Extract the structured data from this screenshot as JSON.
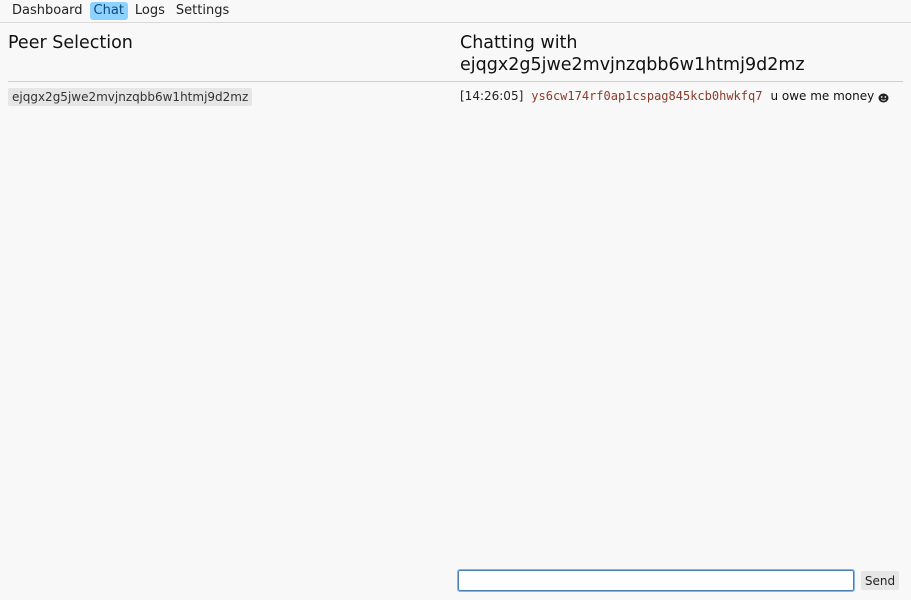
{
  "nav": {
    "tabs": [
      {
        "label": "Dashboard",
        "active": false
      },
      {
        "label": "Chat",
        "active": true
      },
      {
        "label": "Logs",
        "active": false
      },
      {
        "label": "Settings",
        "active": false
      }
    ]
  },
  "peers": {
    "title": "Peer Selection",
    "items": [
      {
        "id": "ejqgx2g5jwe2mvjnzqbb6w1htmj9d2mz"
      }
    ]
  },
  "chat": {
    "title_prefix": "Chatting with",
    "peer_id": "ejqgx2g5jwe2mvjnzqbb6w1htmj9d2mz",
    "messages": [
      {
        "time": "[14:26:05]",
        "sender": "ys6cw174rf0ap1cspag845kcb0hwkfq7",
        "text": "u owe me money",
        "icon": "emoji-icon"
      }
    ],
    "input": {
      "value": "",
      "placeholder": ""
    },
    "send_label": "Send"
  },
  "colors": {
    "active_tab": "#8fd2ff",
    "sender": "#8a3c2a",
    "input_border": "#4a7fb5"
  }
}
